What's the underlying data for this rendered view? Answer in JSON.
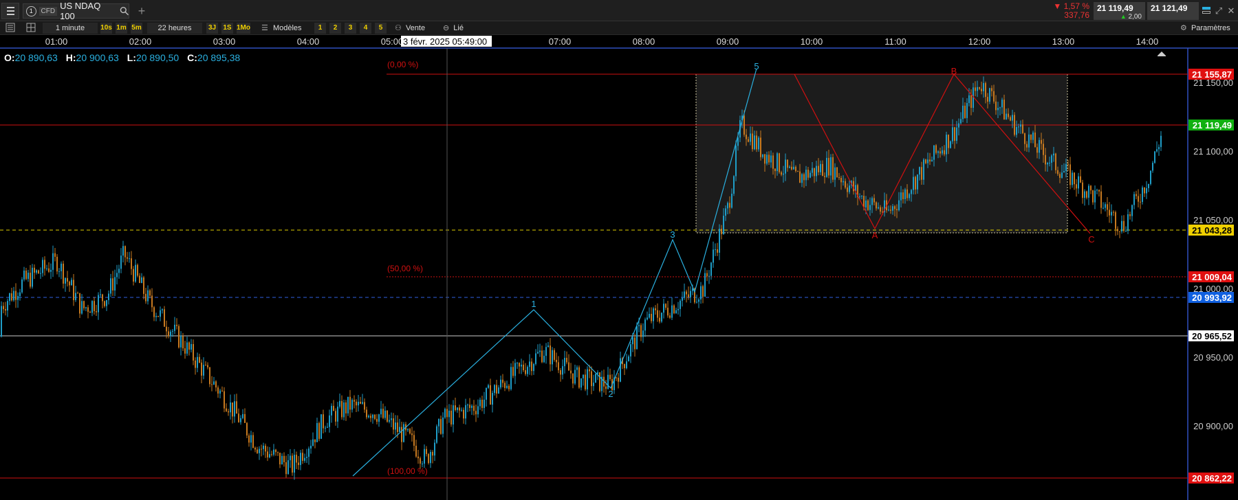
{
  "header": {
    "instrument_number": "1",
    "instrument_type": "CFD",
    "instrument_name": "US NDAQ 100",
    "change_pct": "▼ 1,57 %",
    "change_abs": "337,76",
    "bid": "21 119,49",
    "spread": "2,00",
    "ask": "21 121,49"
  },
  "toolbar": {
    "interval": "1 minute",
    "quick_intervals": [
      "10s",
      "1m",
      "5m"
    ],
    "range": "22 heures",
    "quick_ranges": [
      "3J",
      "1S",
      "1Mo"
    ],
    "templates_label": "Modèles",
    "numbered_buttons": [
      "1",
      "2",
      "3",
      "4",
      "5"
    ],
    "sell_label": "Vente",
    "linked_label": "Lié",
    "settings_label": "Paramètres"
  },
  "ohlc": {
    "o_label": "O:",
    "o": "20 890,63",
    "h_label": "H:",
    "h": "20 900,63",
    "l_label": "L:",
    "l": "20 890,50",
    "c_label": "C:",
    "c": "20 895,38"
  },
  "chart_data": {
    "type": "candlestick",
    "instrument": "US NDAQ 100",
    "x_ticks": [
      "01:00",
      "02:00",
      "03:00",
      "04:00",
      "05:00",
      "07:00",
      "08:00",
      "09:00",
      "10:00",
      "11:00",
      "12:00",
      "13:00",
      "14:00"
    ],
    "y_ticks": [
      "21 150,00",
      "21 100,00",
      "21 050,00",
      "21 000,00",
      "20 950,00",
      "20 900,00"
    ],
    "crosshair_label": "3 févr. 2025 05:49:00",
    "fib_labels": [
      "(0,00 %)",
      "(50,00 %)",
      "(100,00 %)"
    ],
    "wave_labels_blue": [
      "1",
      "2",
      "3",
      "5"
    ],
    "wave_labels_red": [
      "A",
      "B",
      "C"
    ],
    "price_tags": [
      {
        "value": "21 155,87",
        "color": "#e01010"
      },
      {
        "value": "21 119,49",
        "color": "#10b010"
      },
      {
        "value": "21 043,28",
        "color": "#f0d000"
      },
      {
        "value": "21 009,04",
        "color": "#e01010"
      },
      {
        "value": "20 993,92",
        "color": "#1060e0"
      },
      {
        "value": "20 965,52",
        "color": "#ffffff"
      },
      {
        "value": "20 862,22",
        "color": "#e01010"
      }
    ],
    "price_path": [
      [
        0,
        20965
      ],
      [
        0.3,
        20985
      ],
      [
        0.6,
        21005
      ],
      [
        1.0,
        21020
      ],
      [
        1.3,
        20985
      ],
      [
        1.6,
        20995
      ],
      [
        1.8,
        21025
      ],
      [
        2.1,
        20990
      ],
      [
        2.5,
        20960
      ],
      [
        3.0,
        20920
      ],
      [
        3.4,
        20885
      ],
      [
        3.8,
        20870
      ],
      [
        4.2,
        20905
      ],
      [
        4.5,
        20915
      ],
      [
        4.8,
        20910
      ],
      [
        5.2,
        20890
      ],
      [
        5.4,
        20875
      ],
      [
        5.6,
        20905
      ],
      [
        6.0,
        20915
      ],
      [
        6.5,
        20940
      ],
      [
        6.8,
        20955
      ],
      [
        7.2,
        20935
      ],
      [
        7.6,
        20930
      ],
      [
        8.0,
        20975
      ],
      [
        8.4,
        20990
      ],
      [
        8.7,
        21000
      ],
      [
        9.0,
        21060
      ],
      [
        9.15,
        21120
      ],
      [
        9.4,
        21100
      ],
      [
        9.8,
        21080
      ],
      [
        10.2,
        21090
      ],
      [
        10.6,
        21065
      ],
      [
        10.9,
        21055
      ],
      [
        11.3,
        21085
      ],
      [
        11.7,
        21115
      ],
      [
        12.0,
        21150
      ],
      [
        12.4,
        21120
      ],
      [
        12.8,
        21095
      ],
      [
        13.1,
        21080
      ],
      [
        13.4,
        21065
      ],
      [
        13.7,
        21045
      ],
      [
        14.0,
        21080
      ],
      [
        14.2,
        21120
      ]
    ]
  }
}
